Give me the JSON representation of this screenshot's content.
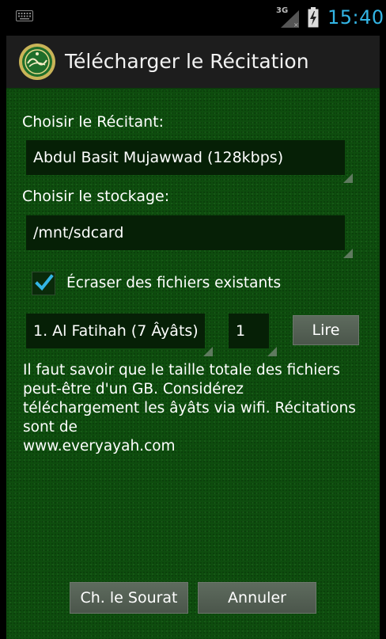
{
  "status_bar": {
    "network": "3G",
    "time": "15:40",
    "accent_color": "#33b5e5"
  },
  "title_bar": {
    "title": "Télécharger le Récitation",
    "logo_icon": "quran-logo-icon"
  },
  "form": {
    "reciter_label": "Choisir le Récitant:",
    "reciter_value": "Abdul Basit Mujawwad (128kbps)",
    "storage_label": "Choisir le stockage:",
    "storage_value": "/mnt/sdcard",
    "overwrite_label": "Écraser des fichiers existants",
    "overwrite_checked": true,
    "surah_value": "1. Al Fatihah (7 Âyâts)",
    "ayah_value": "1",
    "read_button": "Lire"
  },
  "info": {
    "line1": "Il faut savoir que le taille totale des fichiers",
    "line2": "peut-être d'un GB. Considérez",
    "line3": "téléchargement les âyâts via wifi. Récitations",
    "line4": "sont de",
    "line5": "www.everyayah.com"
  },
  "footer": {
    "choose_surah_button": "Ch. le Sourat",
    "cancel_button": "Annuler"
  }
}
